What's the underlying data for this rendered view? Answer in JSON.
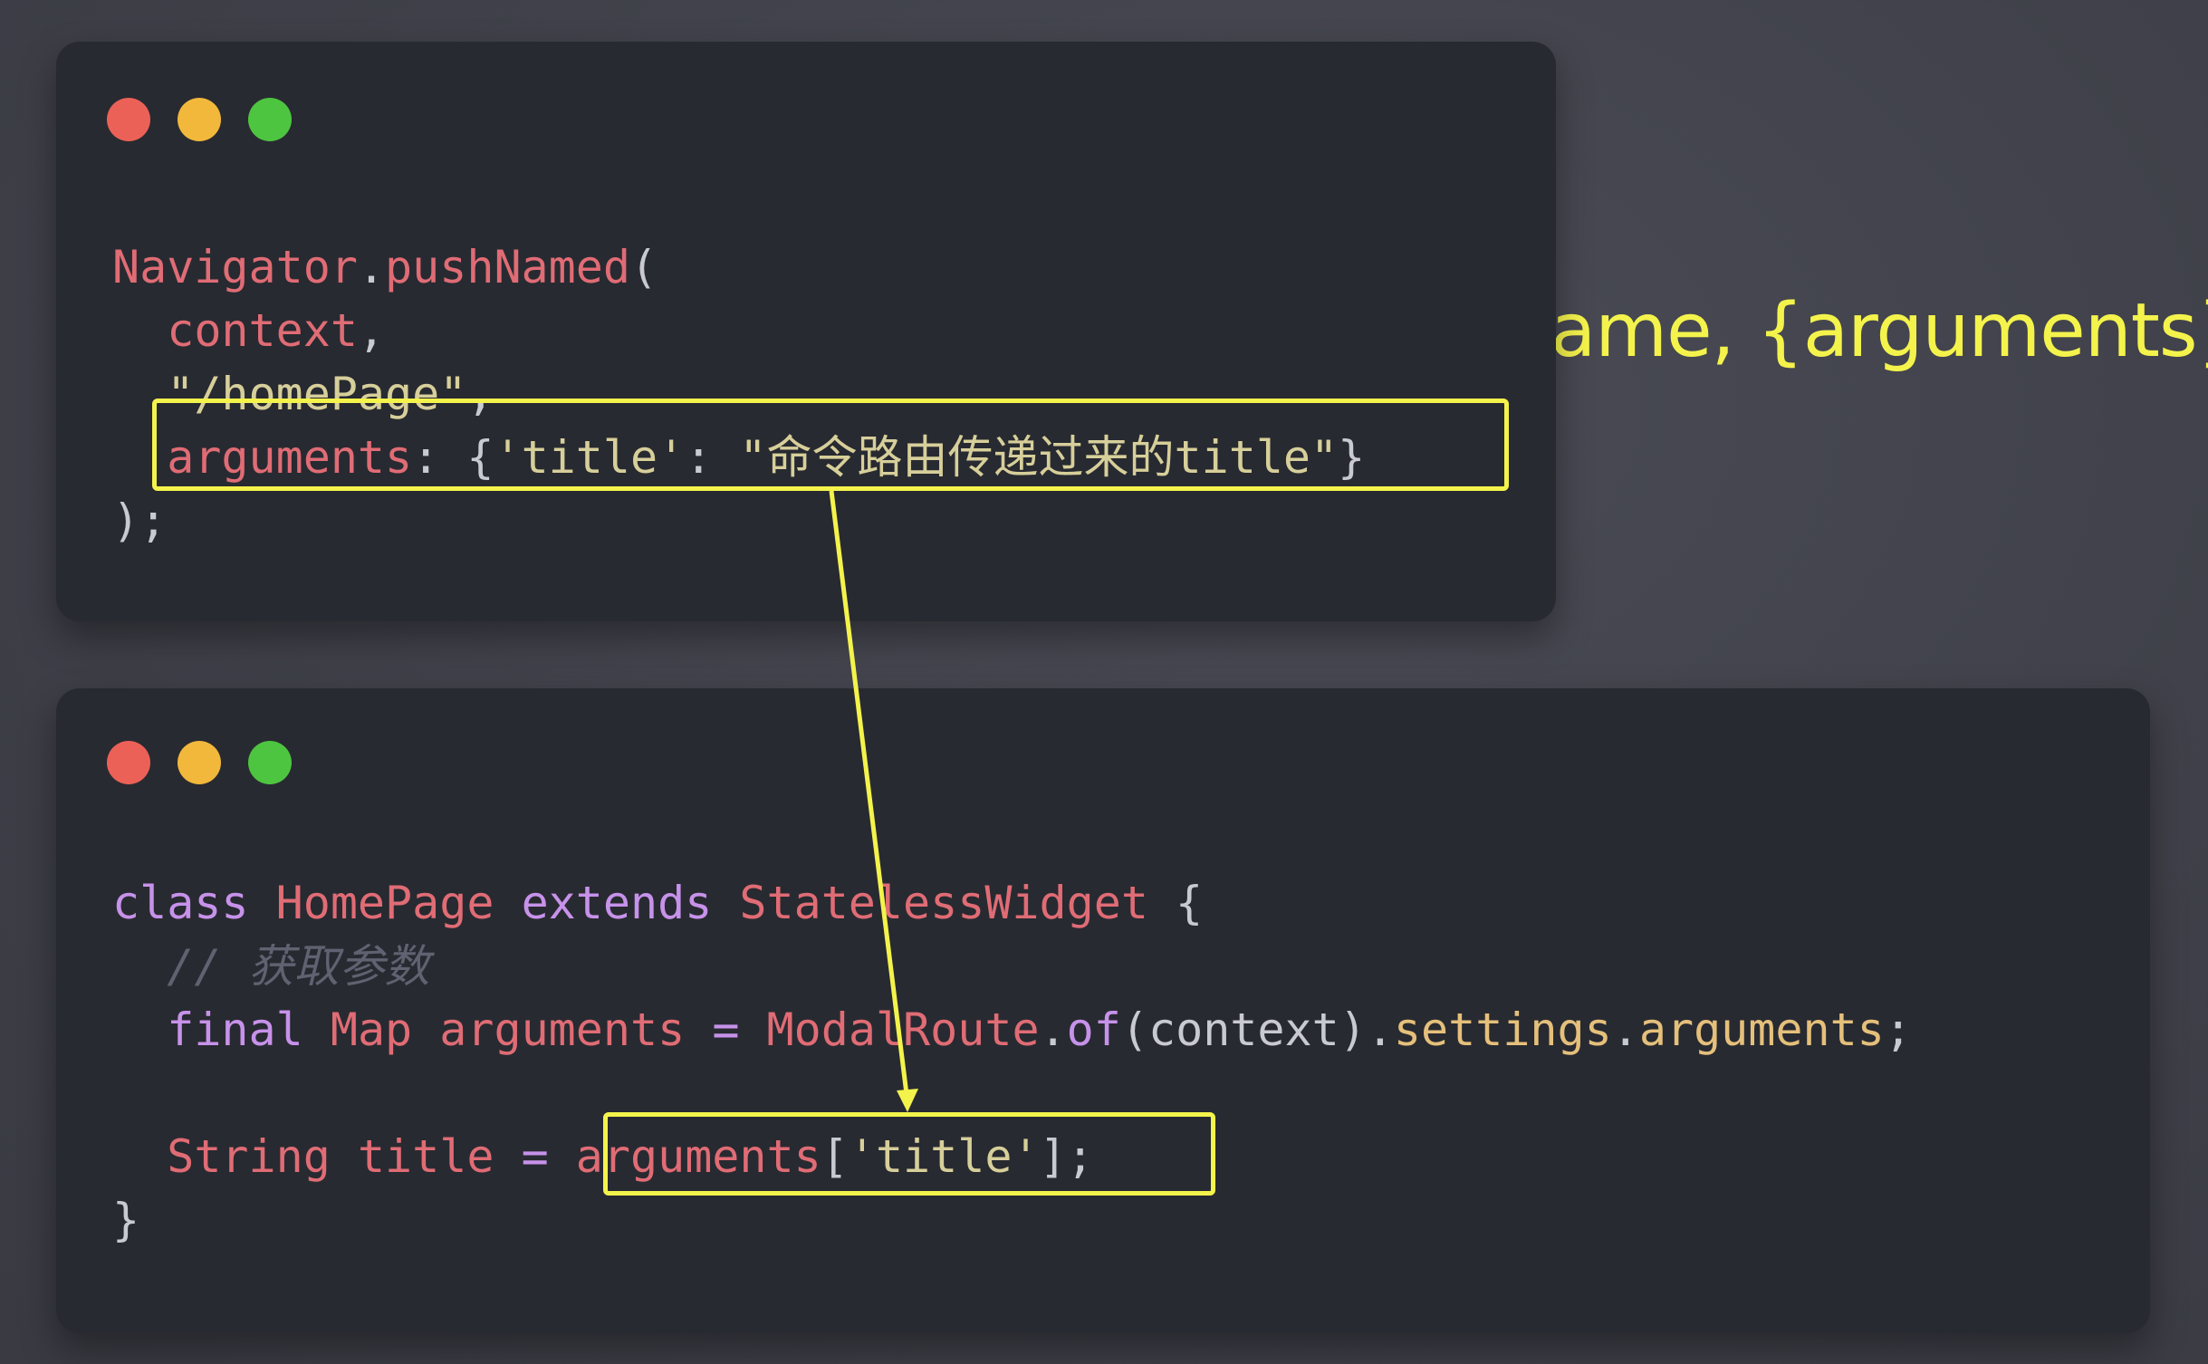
{
  "background_text": "ame, {arguments})",
  "colors": {
    "accent": "#f4f34c",
    "card_bg": "#282a31",
    "window_red": "#ec6157",
    "window_yellow": "#f2b83b",
    "window_green": "#4ec540"
  },
  "snippet1": {
    "l1": {
      "a": "Navigator",
      "b": ".",
      "c": "pushNamed",
      "d": "("
    },
    "l2": {
      "a": "context",
      "b": ","
    },
    "l3": {
      "a": "\"/homePage\"",
      "b": ","
    },
    "l4": {
      "a": "arguments",
      "b": ": {",
      "c": "'title'",
      "d": ": ",
      "e": "\"命令路由传递过来的title\"",
      "f": "}"
    },
    "l5": {
      "a": ");"
    }
  },
  "snippet2": {
    "l1": {
      "a": "class",
      "b": "HomePage",
      "c": "extends",
      "d": "StatelessWidget",
      "e": "{"
    },
    "l2": {
      "a": "// 获取参数"
    },
    "l3": {
      "a": "final",
      "b": "Map",
      "c": "arguments",
      "d": "=",
      "e": "ModalRoute",
      "f": ".",
      "g": "of",
      "h": "(context).",
      "i": "settings",
      "j": ".",
      "k": "arguments",
      "l": ";"
    },
    "l5": {
      "a": "String",
      "b": "title",
      "c": "=",
      "d": "arguments",
      "e": "[",
      "f": "'title'",
      "g": "];"
    },
    "l6": {
      "a": "}"
    }
  }
}
